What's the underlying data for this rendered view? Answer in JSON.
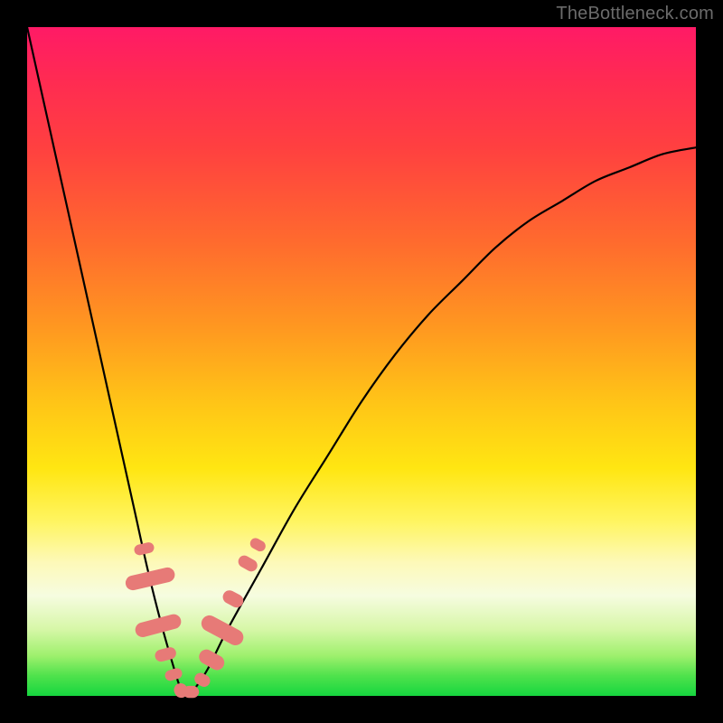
{
  "watermark": "TheBottleneck.com",
  "colors": {
    "frame": "#000000",
    "curve": "#000000",
    "marker": "#e77a77"
  },
  "chart_data": {
    "type": "line",
    "title": "",
    "xlabel": "",
    "ylabel": "",
    "xlim": [
      0,
      100
    ],
    "ylim": [
      0,
      100
    ],
    "grid": false,
    "legend": false,
    "series": [
      {
        "name": "bottleneck-curve",
        "x": [
          0,
          2,
          4,
          6,
          8,
          10,
          12,
          14,
          16,
          18,
          20,
          22,
          23,
          24,
          25,
          27,
          30,
          35,
          40,
          45,
          50,
          55,
          60,
          65,
          70,
          75,
          80,
          85,
          90,
          95,
          100
        ],
        "y": [
          100,
          91,
          82,
          73,
          64,
          55,
          46,
          37,
          28,
          19,
          11,
          4,
          1,
          0,
          1,
          4,
          10,
          19,
          28,
          36,
          44,
          51,
          57,
          62,
          67,
          71,
          74,
          77,
          79,
          81,
          82
        ]
      }
    ],
    "markers": [
      {
        "x": 17.5,
        "y": 22.0,
        "w": 1.6,
        "h": 3.0
      },
      {
        "x": 18.4,
        "y": 17.5,
        "w": 2.2,
        "h": 7.5
      },
      {
        "x": 19.6,
        "y": 10.5,
        "w": 2.2,
        "h": 7.0
      },
      {
        "x": 20.7,
        "y": 6.2,
        "w": 1.8,
        "h": 3.2
      },
      {
        "x": 21.9,
        "y": 3.2,
        "w": 1.6,
        "h": 2.6
      },
      {
        "x": 23.0,
        "y": 0.8,
        "w": 2.2,
        "h": 2.0
      },
      {
        "x": 24.5,
        "y": 0.6,
        "w": 2.4,
        "h": 1.8
      },
      {
        "x": 26.2,
        "y": 2.4,
        "w": 1.8,
        "h": 2.4
      },
      {
        "x": 27.6,
        "y": 5.4,
        "w": 2.2,
        "h": 4.0
      },
      {
        "x": 29.2,
        "y": 9.8,
        "w": 2.4,
        "h": 6.8
      },
      {
        "x": 30.8,
        "y": 14.5,
        "w": 2.0,
        "h": 3.2
      },
      {
        "x": 33.0,
        "y": 19.8,
        "w": 1.8,
        "h": 3.0
      },
      {
        "x": 34.5,
        "y": 22.6,
        "w": 1.6,
        "h": 2.4
      }
    ]
  }
}
